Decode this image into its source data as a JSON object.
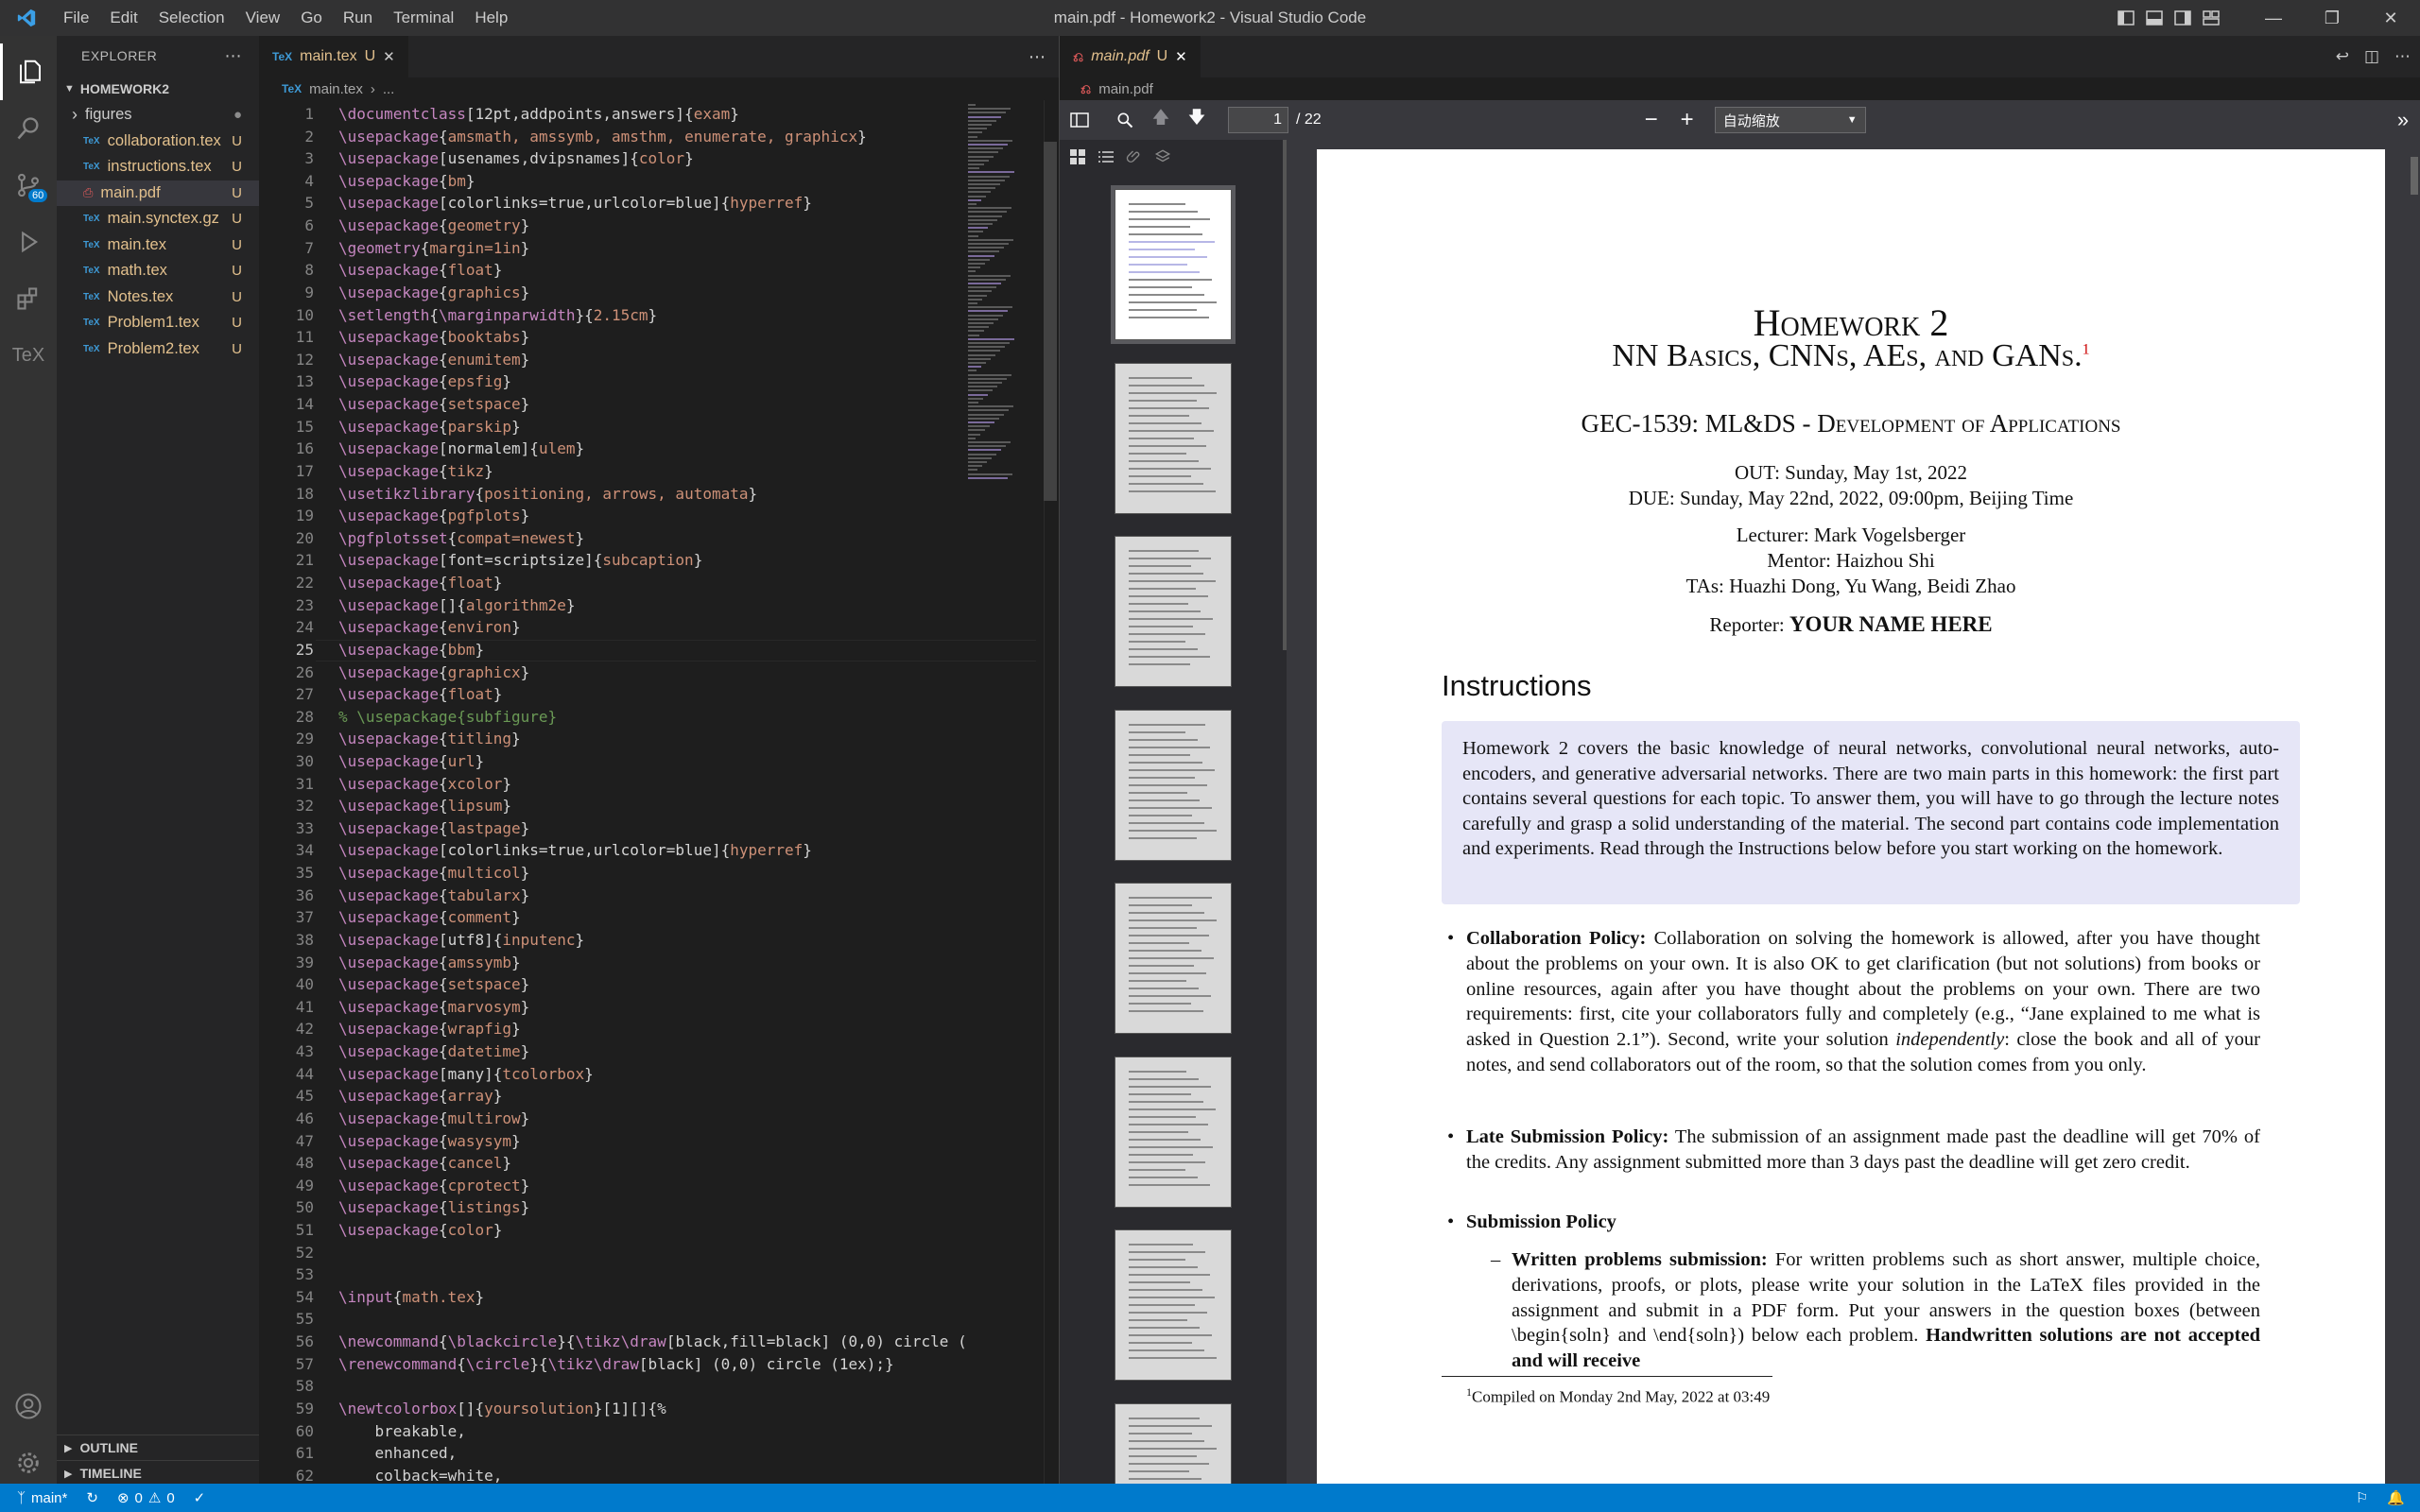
{
  "window": {
    "title": "main.pdf - Homework2 - Visual Studio Code",
    "menu": [
      "File",
      "Edit",
      "Selection",
      "View",
      "Go",
      "Run",
      "Terminal",
      "Help"
    ]
  },
  "activity": {
    "source_control_badge": "60",
    "tex_label": "TeX"
  },
  "explorer": {
    "header": "EXPLORER",
    "folder": "HOMEWORK2",
    "files": [
      {
        "name": "figures",
        "status": "●",
        "type": "folder"
      },
      {
        "name": "collaboration.tex",
        "status": "U",
        "type": "tex"
      },
      {
        "name": "instructions.tex",
        "status": "U",
        "type": "tex"
      },
      {
        "name": "main.pdf",
        "status": "U",
        "type": "pdf"
      },
      {
        "name": "main.synctex.gz",
        "status": "U",
        "type": "tex"
      },
      {
        "name": "main.tex",
        "status": "U",
        "type": "tex"
      },
      {
        "name": "math.tex",
        "status": "U",
        "type": "tex"
      },
      {
        "name": "Notes.tex",
        "status": "U",
        "type": "tex"
      },
      {
        "name": "Problem1.tex",
        "status": "U",
        "type": "tex"
      },
      {
        "name": "Problem2.tex",
        "status": "U",
        "type": "tex"
      }
    ],
    "outline": "OUTLINE",
    "timeline": "TIMELINE"
  },
  "editor": {
    "tab": {
      "name": "main.tex",
      "status": "U"
    },
    "breadcrumb": [
      "main.tex",
      "..."
    ],
    "current_line": 25,
    "lines": [
      "\\documentclass[12pt,addpoints,answers]{exam}",
      "\\usepackage{amsmath, amssymb, amsthm, enumerate, graphicx}",
      "\\usepackage[usenames,dvipsnames]{color}",
      "\\usepackage{bm}",
      "\\usepackage[colorlinks=true,urlcolor=blue]{hyperref}",
      "\\usepackage{geometry}",
      "\\geometry{margin=1in}",
      "\\usepackage{float}",
      "\\usepackage{graphics}",
      "\\setlength{\\marginparwidth}{2.15cm}",
      "\\usepackage{booktabs}",
      "\\usepackage{enumitem}",
      "\\usepackage{epsfig}",
      "\\usepackage{setspace}",
      "\\usepackage{parskip}",
      "\\usepackage[normalem]{ulem}",
      "\\usepackage{tikz}",
      "\\usetikzlibrary{positioning, arrows, automata}",
      "\\usepackage{pgfplots}",
      "\\pgfplotsset{compat=newest}",
      "\\usepackage[font=scriptsize]{subcaption}",
      "\\usepackage{float}",
      "\\usepackage[]{algorithm2e}",
      "\\usepackage{environ}",
      "\\usepackage{bbm}",
      "\\usepackage{graphicx}",
      "\\usepackage{float}",
      "% \\usepackage{subfigure}",
      "\\usepackage{titling}",
      "\\usepackage{url}",
      "\\usepackage{xcolor}",
      "\\usepackage{lipsum}",
      "\\usepackage{lastpage}",
      "\\usepackage[colorlinks=true,urlcolor=blue]{hyperref}",
      "\\usepackage{multicol}",
      "\\usepackage{tabularx}",
      "\\usepackage{comment}",
      "\\usepackage[utf8]{inputenc}",
      "\\usepackage{amssymb}",
      "\\usepackage{setspace}",
      "\\usepackage{marvosym}",
      "\\usepackage{wrapfig}",
      "\\usepackage{datetime}",
      "\\usepackage[many]{tcolorbox}",
      "\\usepackage{array}",
      "\\usepackage{multirow}",
      "\\usepackage{wasysym}",
      "\\usepackage{cancel}",
      "\\usepackage{cprotect}",
      "\\usepackage{listings}",
      "\\usepackage{color}",
      "",
      "",
      "\\input{math.tex}",
      "",
      "\\newcommand{\\blackcircle}{\\tikz\\draw[black,fill=black] (0,0) circle (",
      "\\renewcommand{\\circle}{\\tikz\\draw[black] (0,0) circle (1ex);}",
      "",
      "\\newtcolorbox[]{yoursolution}[1][]{%",
      "    breakable,",
      "    enhanced,",
      "    colback=white,"
    ]
  },
  "pdf": {
    "tab": {
      "name": "main.pdf",
      "status": "U"
    },
    "breadcrumb": "main.pdf",
    "page_current": "1",
    "page_total": "/ 22",
    "zoom": "自动缩放",
    "page": {
      "title": "Homework 2",
      "subtitle": "NN Basics, CNNs, AEs, and GANs.",
      "subtitle_mark": "1",
      "course": "GEC-1539: ML&DS - Development of Applications",
      "out": "OUT: Sunday, May 1st, 2022",
      "due": "DUE: Sunday, May 22nd, 2022, 09:00pm, Beijing Time",
      "lecturer": "Lecturer: Mark Vogelsberger",
      "mentor": "Mentor: Haizhou Shi",
      "tas": "TAs: Huazhi Dong, Yu Wang, Beidi Zhao",
      "reporter_label": "Reporter:",
      "reporter_name": "YOUR NAME HERE",
      "section": "Instructions",
      "box_text": "Homework 2 covers the basic knowledge of neural networks, convolutional neural networks, auto-encoders, and generative adversarial networks. There are two main parts in this homework: the first part contains several questions for each topic. To answer them, you will have to go through the lecture notes carefully and grasp a solid understanding of the material. The second part contains code implementation and experiments. Read through the Instructions below before you start working on the homework.",
      "collab_head": "Collaboration Policy:",
      "collab_text": "Collaboration on solving the homework is allowed, after you have thought about the problems on your own. It is also OK to get clarification (but not solutions) from books or online resources, again after you have thought about the problems on your own. There are two requirements: first, cite your collaborators fully and completely (e.g., “Jane explained to me what is asked in Question 2.1”). Second, write your solution",
      "collab_italic": "independently",
      "collab_tail": ": close the book and all of your notes, and send collaborators out of the room, so that the solution comes from you only.",
      "late_head": "Late Submission Policy:",
      "late_text": "The submission of an assignment made past the deadline will get 70% of the credits. Any assignment submitted more than 3 days past the deadline will get zero credit.",
      "submission_head": "Submission Policy",
      "written_head": "Written problems submission:",
      "written_text": "For written problems such as short answer, multiple choice, derivations, proofs, or plots, please write your solution in the LaTeX files provided in the assignment and submit in a PDF form. Put your answers in the question boxes (between \\begin{soln} and \\end{soln}) below each problem.",
      "written_bold_tail": "Handwritten solutions are not accepted and will receive",
      "footnote_text": "Compiled on Monday 2nd May, 2022 at 03:49"
    }
  },
  "status": {
    "branch": "main*",
    "problems": "0",
    "warnings": "0"
  }
}
